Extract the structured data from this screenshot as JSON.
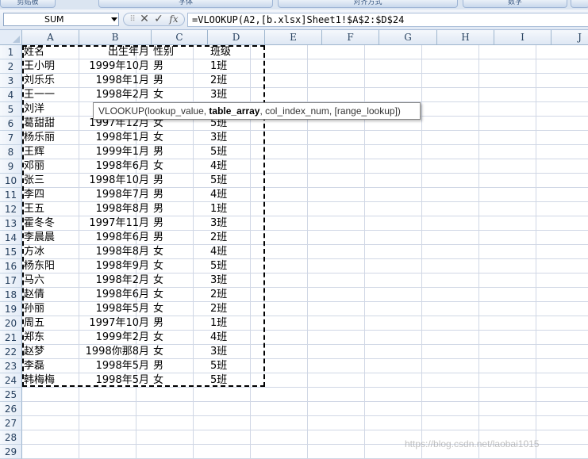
{
  "ribbon": {
    "groups": [
      "剪贴板",
      "字体",
      "对齐方式",
      "数字"
    ]
  },
  "formula_bar": {
    "name_box": "SUM",
    "buttons": [
      {
        "name": "cancel-formula-button",
        "glyph": "✕"
      },
      {
        "name": "confirm-formula-button",
        "glyph": "✓"
      },
      {
        "name": "insert-function-button",
        "glyph": "fx"
      }
    ],
    "formula": "=VLOOKUP(A2,[b.xlsx]Sheet1!$A$2:$D$24"
  },
  "columns": [
    "A",
    "B",
    "C",
    "D",
    "E",
    "F",
    "G",
    "H",
    "I",
    "J"
  ],
  "rows": [
    "1",
    "2",
    "3",
    "4",
    "5",
    "6",
    "7",
    "8",
    "9",
    "10",
    "11",
    "12",
    "13",
    "14",
    "15",
    "16",
    "17",
    "18",
    "19",
    "20",
    "21",
    "22",
    "23",
    "24",
    "25",
    "26",
    "27",
    "28",
    "29"
  ],
  "table": {
    "headers": [
      "姓名",
      "出生年月",
      "性别",
      "班级"
    ],
    "records": [
      [
        "王小明",
        "1999年10月",
        "男",
        "1班"
      ],
      [
        "刘乐乐",
        "1998年1月",
        "男",
        "2班"
      ],
      [
        "王一一",
        "1998年2月",
        "女",
        "3班"
      ],
      [
        "刘洋",
        "",
        "",
        ""
      ],
      [
        "葛甜甜",
        "1997年12月",
        "女",
        "5班"
      ],
      [
        "杨乐丽",
        "1998年1月",
        "女",
        "3班"
      ],
      [
        "王辉",
        "1999年1月",
        "男",
        "5班"
      ],
      [
        "邓丽",
        "1998年6月",
        "女",
        "4班"
      ],
      [
        "张三",
        "1998年10月",
        "男",
        "5班"
      ],
      [
        "李四",
        "1998年7月",
        "男",
        "4班"
      ],
      [
        "王五",
        "1998年8月",
        "男",
        "1班"
      ],
      [
        "霍冬冬",
        "1997年11月",
        "男",
        "3班"
      ],
      [
        "李晨晨",
        "1998年6月",
        "男",
        "2班"
      ],
      [
        "方冰",
        "1998年8月",
        "女",
        "4班"
      ],
      [
        "杨东阳",
        "1998年9月",
        "女",
        "5班"
      ],
      [
        "马六",
        "1998年2月",
        "女",
        "3班"
      ],
      [
        "赵倩",
        "1998年6月",
        "女",
        "2班"
      ],
      [
        "孙丽",
        "1998年5月",
        "女",
        "2班"
      ],
      [
        "周五",
        "1997年10月",
        "男",
        "1班"
      ],
      [
        "郑东",
        "1999年2月",
        "女",
        "4班"
      ],
      [
        "赵梦",
        "1998你那8月",
        "女",
        "3班"
      ],
      [
        "李磊",
        "1998年5月",
        "男",
        "5班"
      ],
      [
        "韩梅梅",
        "1998年5月",
        "女",
        "5班"
      ]
    ]
  },
  "tooltip": {
    "fn": "VLOOKUP(",
    "arg1": "lookup_value, ",
    "arg2": "table_array",
    "rest": ", col_index_num, [range_lookup])"
  },
  "watermark": "https://blog.csdn.net/laobai1015",
  "colors": {
    "grid": "#d0d7e5",
    "header_bg": "#e4ecf7",
    "header_text": "#27415f"
  }
}
